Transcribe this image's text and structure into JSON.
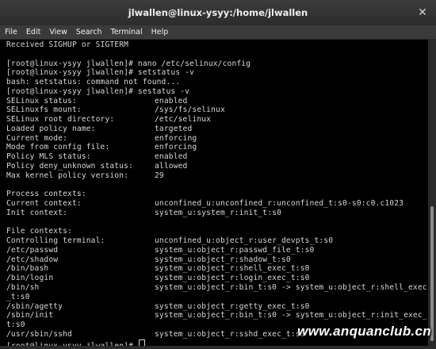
{
  "window": {
    "title": "jlwallen@linux-ysyy:/home/jlwallen",
    "close_glyph": "✕"
  },
  "menu": [
    "File",
    "Edit",
    "View",
    "Search",
    "Terminal",
    "Help"
  ],
  "terminal": {
    "lines": [
      {
        "left": "Received SIGHUP or SIGTERM"
      },
      {
        "left": ""
      },
      {
        "left": "[root@linux-ysyy jlwallen]# nano /etc/selinux/config"
      },
      {
        "left": "[root@linux-ysyy jlwallen]# setstatus -v"
      },
      {
        "left": "bash: setstatus: command not found..."
      },
      {
        "left": "[root@linux-ysyy jlwallen]# sestatus -v"
      },
      {
        "left": "SELinux status:",
        "right": "enabled"
      },
      {
        "left": "SELinuxfs mount:",
        "right": "/sys/fs/selinux"
      },
      {
        "left": "SELinux root directory:",
        "right": "/etc/selinux"
      },
      {
        "left": "Loaded policy name:",
        "right": "targeted"
      },
      {
        "left": "Current mode:",
        "right": "enforcing"
      },
      {
        "left": "Mode from config file:",
        "right": "enforcing"
      },
      {
        "left": "Policy MLS status:",
        "right": "enabled"
      },
      {
        "left": "Policy deny_unknown status:",
        "right": "allowed"
      },
      {
        "left": "Max kernel policy version:",
        "right": "29"
      },
      {
        "left": ""
      },
      {
        "left": "Process contexts:"
      },
      {
        "left": "Current context:",
        "right": "unconfined_u:unconfined_r:unconfined_t:s0-s0:c0.c1023"
      },
      {
        "left": "Init context:",
        "right": "system_u:system_r:init_t:s0"
      },
      {
        "left": ""
      },
      {
        "left": "File contexts:"
      },
      {
        "left": "Controlling terminal:",
        "right": "unconfined_u:object_r:user_devpts_t:s0"
      },
      {
        "left": "/etc/passwd",
        "right": "system_u:object_r:passwd_file_t:s0"
      },
      {
        "left": "/etc/shadow",
        "right": "system_u:object_r:shadow_t:s0"
      },
      {
        "left": "/bin/bash",
        "right": "system_u:object_r:shell_exec_t:s0"
      },
      {
        "left": "/bin/login",
        "right": "system_u:object_r:login_exec_t:s0"
      },
      {
        "left": "/bin/sh",
        "right": "system_u:object_r:bin_t:s0 -> system_u:object_r:shell_exec"
      },
      {
        "left": "_t:s0"
      },
      {
        "left": "/sbin/agetty",
        "right": "system_u:object_r:getty_exec_t:s0"
      },
      {
        "left": "/sbin/init",
        "right": "system_u:object_r:bin_t:s0 -> system_u:object_r:init_exec_"
      },
      {
        "left": "t:s0"
      },
      {
        "left": "/usr/sbin/sshd",
        "right": "system_u:object_r:sshd_exec_t:s0"
      },
      {
        "left": "[root@linux-ysyy jlwallen]# ",
        "cursor": true
      }
    ]
  },
  "watermark": "www.anquanclub.cn"
}
